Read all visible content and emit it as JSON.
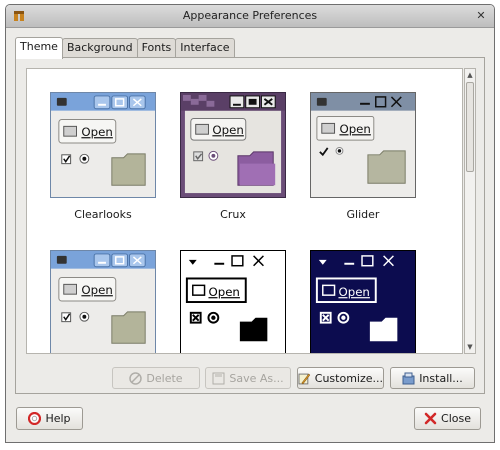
{
  "window": {
    "title": "Appearance Preferences",
    "close_glyph": "✕"
  },
  "tabs": [
    {
      "label": "Theme",
      "active": true
    },
    {
      "label": "Background"
    },
    {
      "label": "Fonts"
    },
    {
      "label": "Interface"
    }
  ],
  "themes": [
    {
      "name": "Clearlooks",
      "open_label": "Open"
    },
    {
      "name": "Crux",
      "open_label": "Open"
    },
    {
      "name": "Glider",
      "open_label": "Open"
    },
    {
      "name": "",
      "open_label": "Open"
    },
    {
      "name": "",
      "open_label": "Open"
    },
    {
      "name": "",
      "open_label": "Open"
    }
  ],
  "actions": {
    "delete_label": "Delete",
    "save_as_label": "Save As...",
    "customize_label": "Customize...",
    "install_label": "Install..."
  },
  "footer": {
    "help_label": "Help",
    "close_label": "Close"
  },
  "colors": {
    "accent_blue": "#5b8fd3",
    "crux_purple": "#6b4d78",
    "hc_navy": "#0c0c4f",
    "close_red": "#d22828"
  }
}
